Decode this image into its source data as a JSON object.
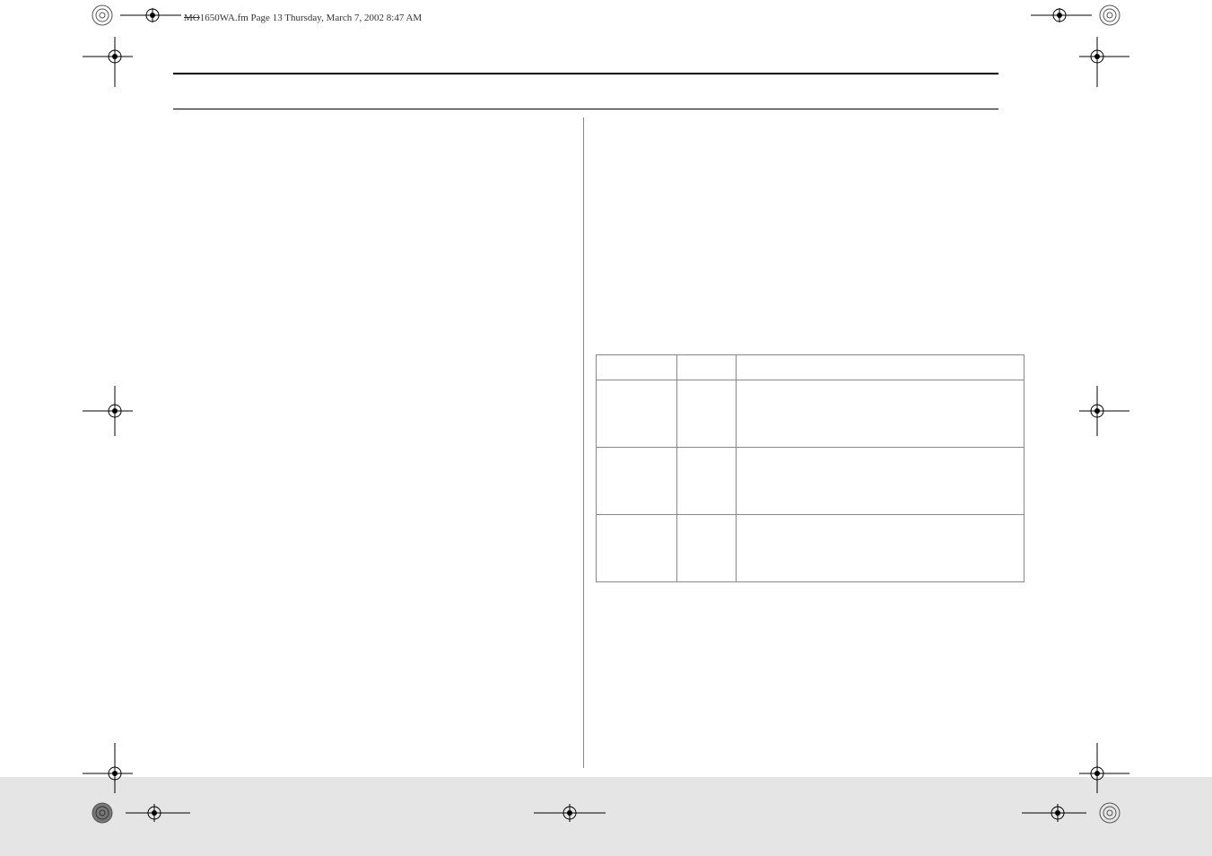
{
  "header": {
    "filename_struck": "MO",
    "filename_rest": "1650WA.fm  Page 13  Thursday, March 7, 2002  8:47 AM"
  },
  "table": {
    "rows": [
      {
        "c1": "",
        "c2": "",
        "c3": ""
      },
      {
        "c1": "",
        "c2": "",
        "c3": ""
      },
      {
        "c1": "",
        "c2": "",
        "c3": ""
      },
      {
        "c1": "",
        "c2": "",
        "c3": ""
      }
    ]
  }
}
